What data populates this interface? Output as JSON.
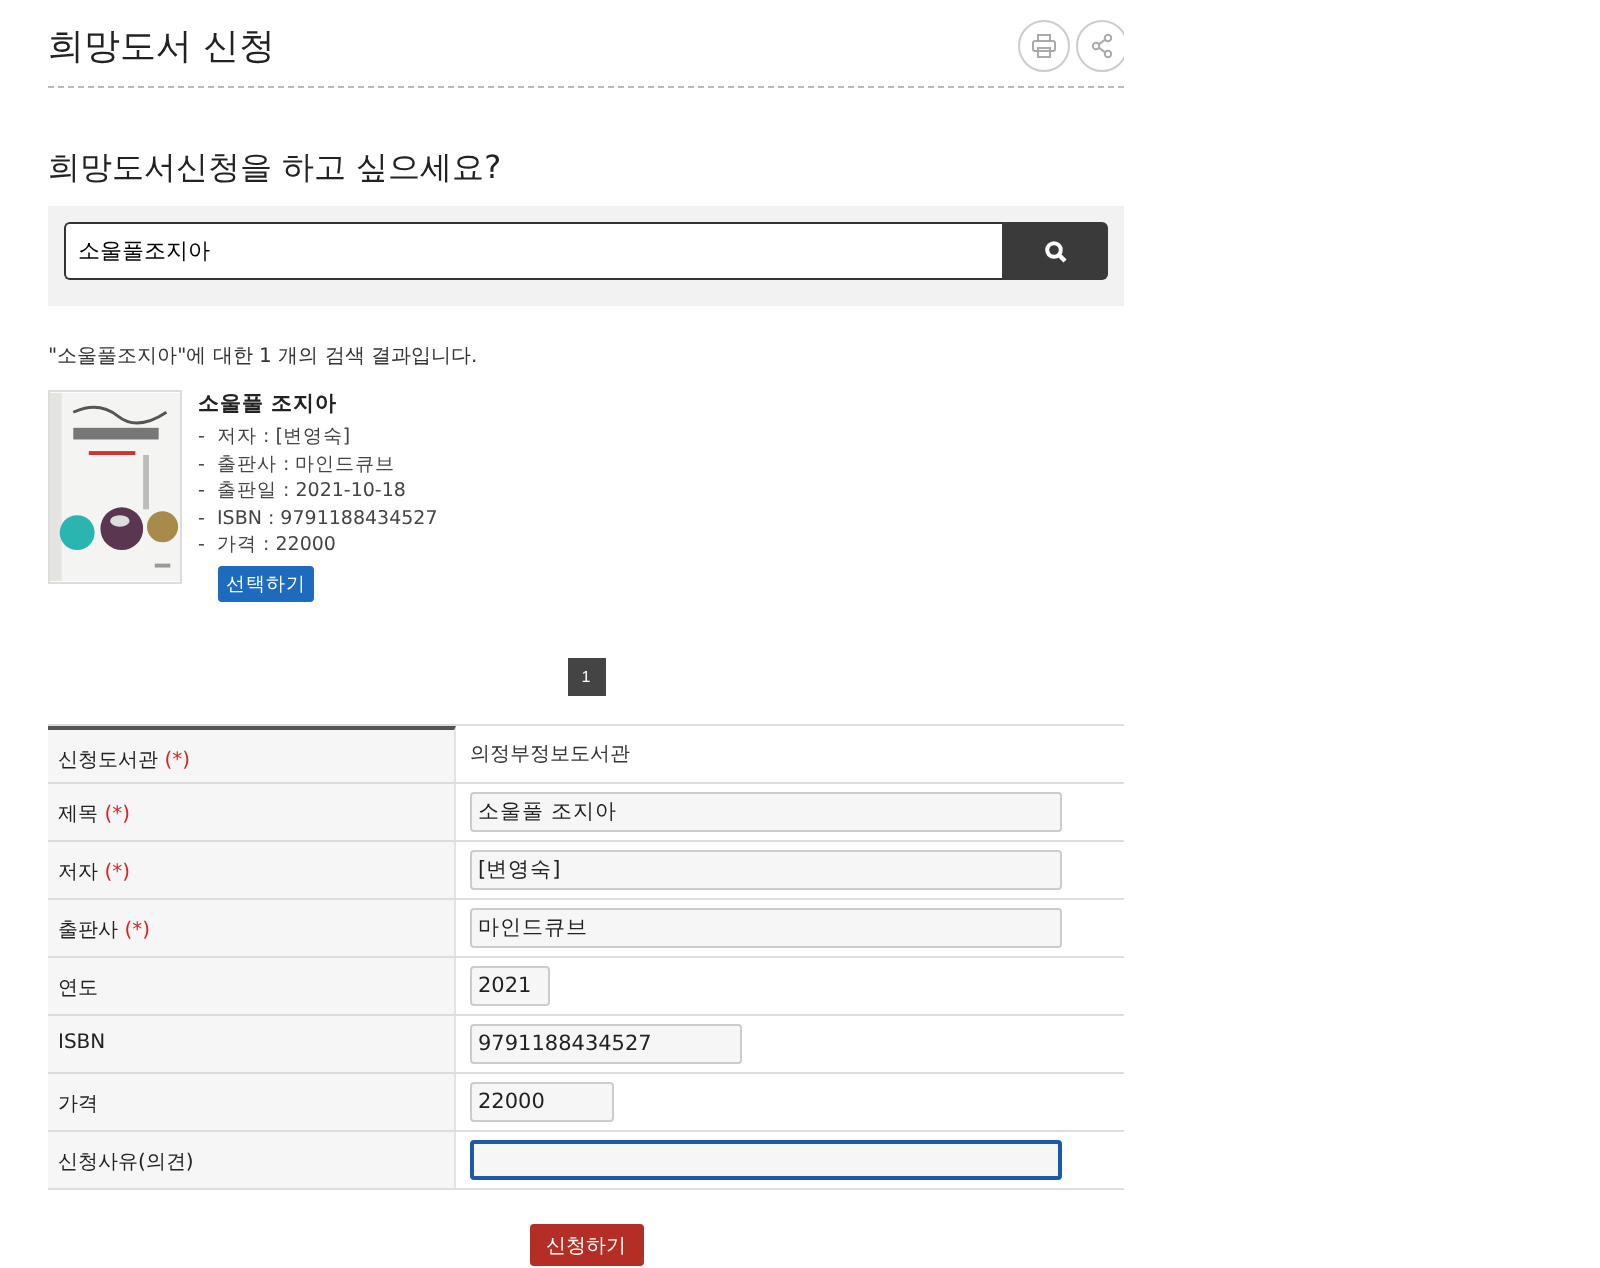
{
  "page_title": "희망도서 신청",
  "heading": "희망도서신청을 하고 싶으세요?",
  "search": {
    "value": "소울풀조지아"
  },
  "result_summary": "\"소울풀조지아\"에 대한 1 개의 검색 결과입니다.",
  "results": [
    {
      "kind": "picture",
      "title": "소울풀 조지아",
      "details": [
        "저자 : [변영숙]",
        "출판사 : 마인드큐브",
        "출판일 : 2021-10-18",
        "ISBN : 9791188434527",
        "가격 : 22000"
      ],
      "dash": "-",
      "select_button": "선택하기"
    }
  ],
  "pages": [
    {
      "label": "1",
      "selected": true
    }
  ],
  "form": [
    {
      "kind": "static",
      "label": "신청도서관",
      "required_mark": "(*)",
      "value": "의정부정보도서관"
    },
    {
      "kind": "wide",
      "label": "제목",
      "required_mark": "(*)",
      "value": "소울풀 조지아",
      "focused": false
    },
    {
      "kind": "wide",
      "label": "저자",
      "required_mark": "(*)",
      "value": "[변영숙]",
      "focused": false
    },
    {
      "kind": "wide",
      "label": "출판사",
      "required_mark": "(*)",
      "value": "마인드큐브",
      "focused": false
    },
    {
      "kind": "small",
      "label": "연도",
      "value": "2021",
      "focused": false
    },
    {
      "kind": "medium",
      "label": "ISBN",
      "value": "9791188434527",
      "focused": false
    },
    {
      "kind": "narrow",
      "label": "가격",
      "value": "22000",
      "focused": false
    },
    {
      "kind": "wide",
      "label": "신청사유(의견)",
      "focused": true
    }
  ],
  "submit_button": "신청하기"
}
